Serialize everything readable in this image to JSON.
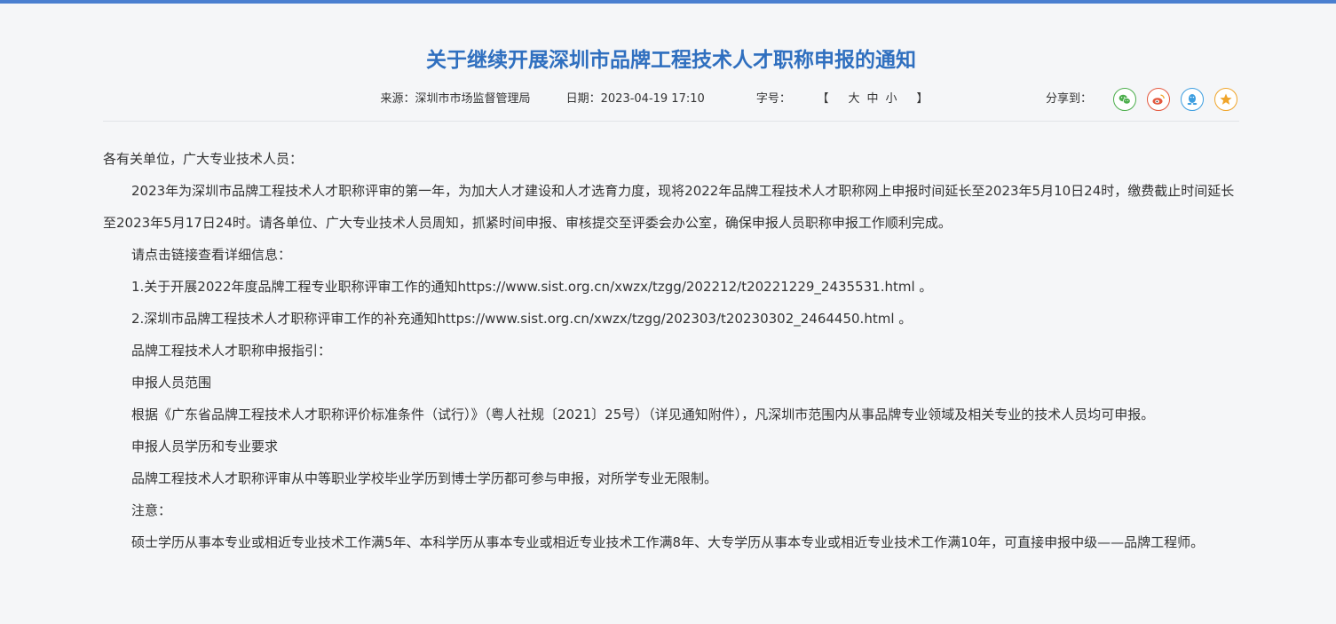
{
  "article": {
    "title": "关于继续开展深圳市品牌工程技术人才职称申报的通知",
    "source_label": "来源：深圳市市场监督管理局",
    "date_label": "日期：2023-04-19 17:10",
    "fontsize_label": "字号：",
    "fontsize_open": "【",
    "fontsize_large": "大",
    "fontsize_medium": "中",
    "fontsize_small": "小",
    "fontsize_close": "】"
  },
  "share": {
    "label": "分享到：",
    "icons": [
      "wechat-icon",
      "weibo-icon",
      "qq-icon",
      "favorite-icon"
    ],
    "colors": {
      "wechat": "#4cae4c",
      "weibo": "#e4583e",
      "qq": "#3d9ee0",
      "favorite": "#f0a52b"
    }
  },
  "accent_color": "#2f6fbf",
  "body": {
    "greeting": "各有关单位，广大专业技术人员：",
    "p1": "2023年为深圳市品牌工程技术人才职称评审的第一年，为加大人才建设和人才选育力度，现将2022年品牌工程技术人才职称网上申报时间延长至2023年5月10日24时，缴费截止时间延长至2023年5月17日24时。请各单位、广大专业技术人员周知，抓紧时间申报、审核提交至评委会办公室，确保申报人员职称申报工作顺利完成。",
    "p2": "请点击链接查看详细信息：",
    "p3": "1.关于开展2022年度品牌工程专业职称评审工作的通知https://www.sist.org.cn/xwzx/tzgg/202212/t20221229_2435531.html 。",
    "p4": "2.深圳市品牌工程技术人才职称评审工作的补充通知https://www.sist.org.cn/xwzx/tzgg/202303/t20230302_2464450.html 。",
    "p5": "品牌工程技术人才职称申报指引：",
    "p6": "申报人员范围",
    "p7": "根据《广东省品牌工程技术人才职称评价标准条件（试行）》（粤人社规〔2021〕25号）（详见通知附件），凡深圳市范围内从事品牌专业领域及相关专业的技术人员均可申报。",
    "p8": "申报人员学历和专业要求",
    "p9": "品牌工程技术人才职称评审从中等职业学校毕业学历到博士学历都可参与申报，对所学专业无限制。",
    "p10": "注意：",
    "p11": "硕士学历从事本专业或相近专业技术工作满5年、本科学历从事本专业或相近专业技术工作满8年、大专学历从事本专业或相近专业技术工作满10年，可直接申报中级——品牌工程师。"
  }
}
